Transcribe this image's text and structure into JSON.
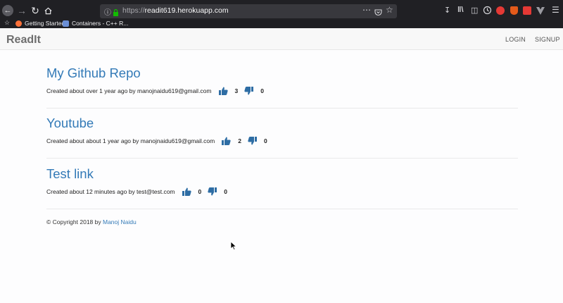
{
  "browser": {
    "url_protocol": "https://",
    "url_host": "readit619.herokuapp.com",
    "bookmarks": [
      {
        "label": "Getting Started"
      },
      {
        "label": "Containers - C++ R..."
      }
    ]
  },
  "navbar": {
    "brand": "ReadIt",
    "login_label": "LOGIN",
    "signup_label": "SIGNUP"
  },
  "posts": [
    {
      "title": "My Github Repo",
      "meta": "Created about over 1 year ago by manojnaidu619@gmail.com",
      "upvotes": "3",
      "downvotes": "0"
    },
    {
      "title": "Youtube",
      "meta": "Created about about 1 year ago by manojnaidu619@gmail.com",
      "upvotes": "2",
      "downvotes": "0"
    },
    {
      "title": "Test link",
      "meta": "Created about 12 minutes ago by test@test.com",
      "upvotes": "0",
      "downvotes": "0"
    }
  ],
  "footer": {
    "text": "© Copyright 2018 by",
    "author": "Manoj Naidu"
  },
  "colors": {
    "link": "#337ab7",
    "thumb": "#2e6da4"
  }
}
